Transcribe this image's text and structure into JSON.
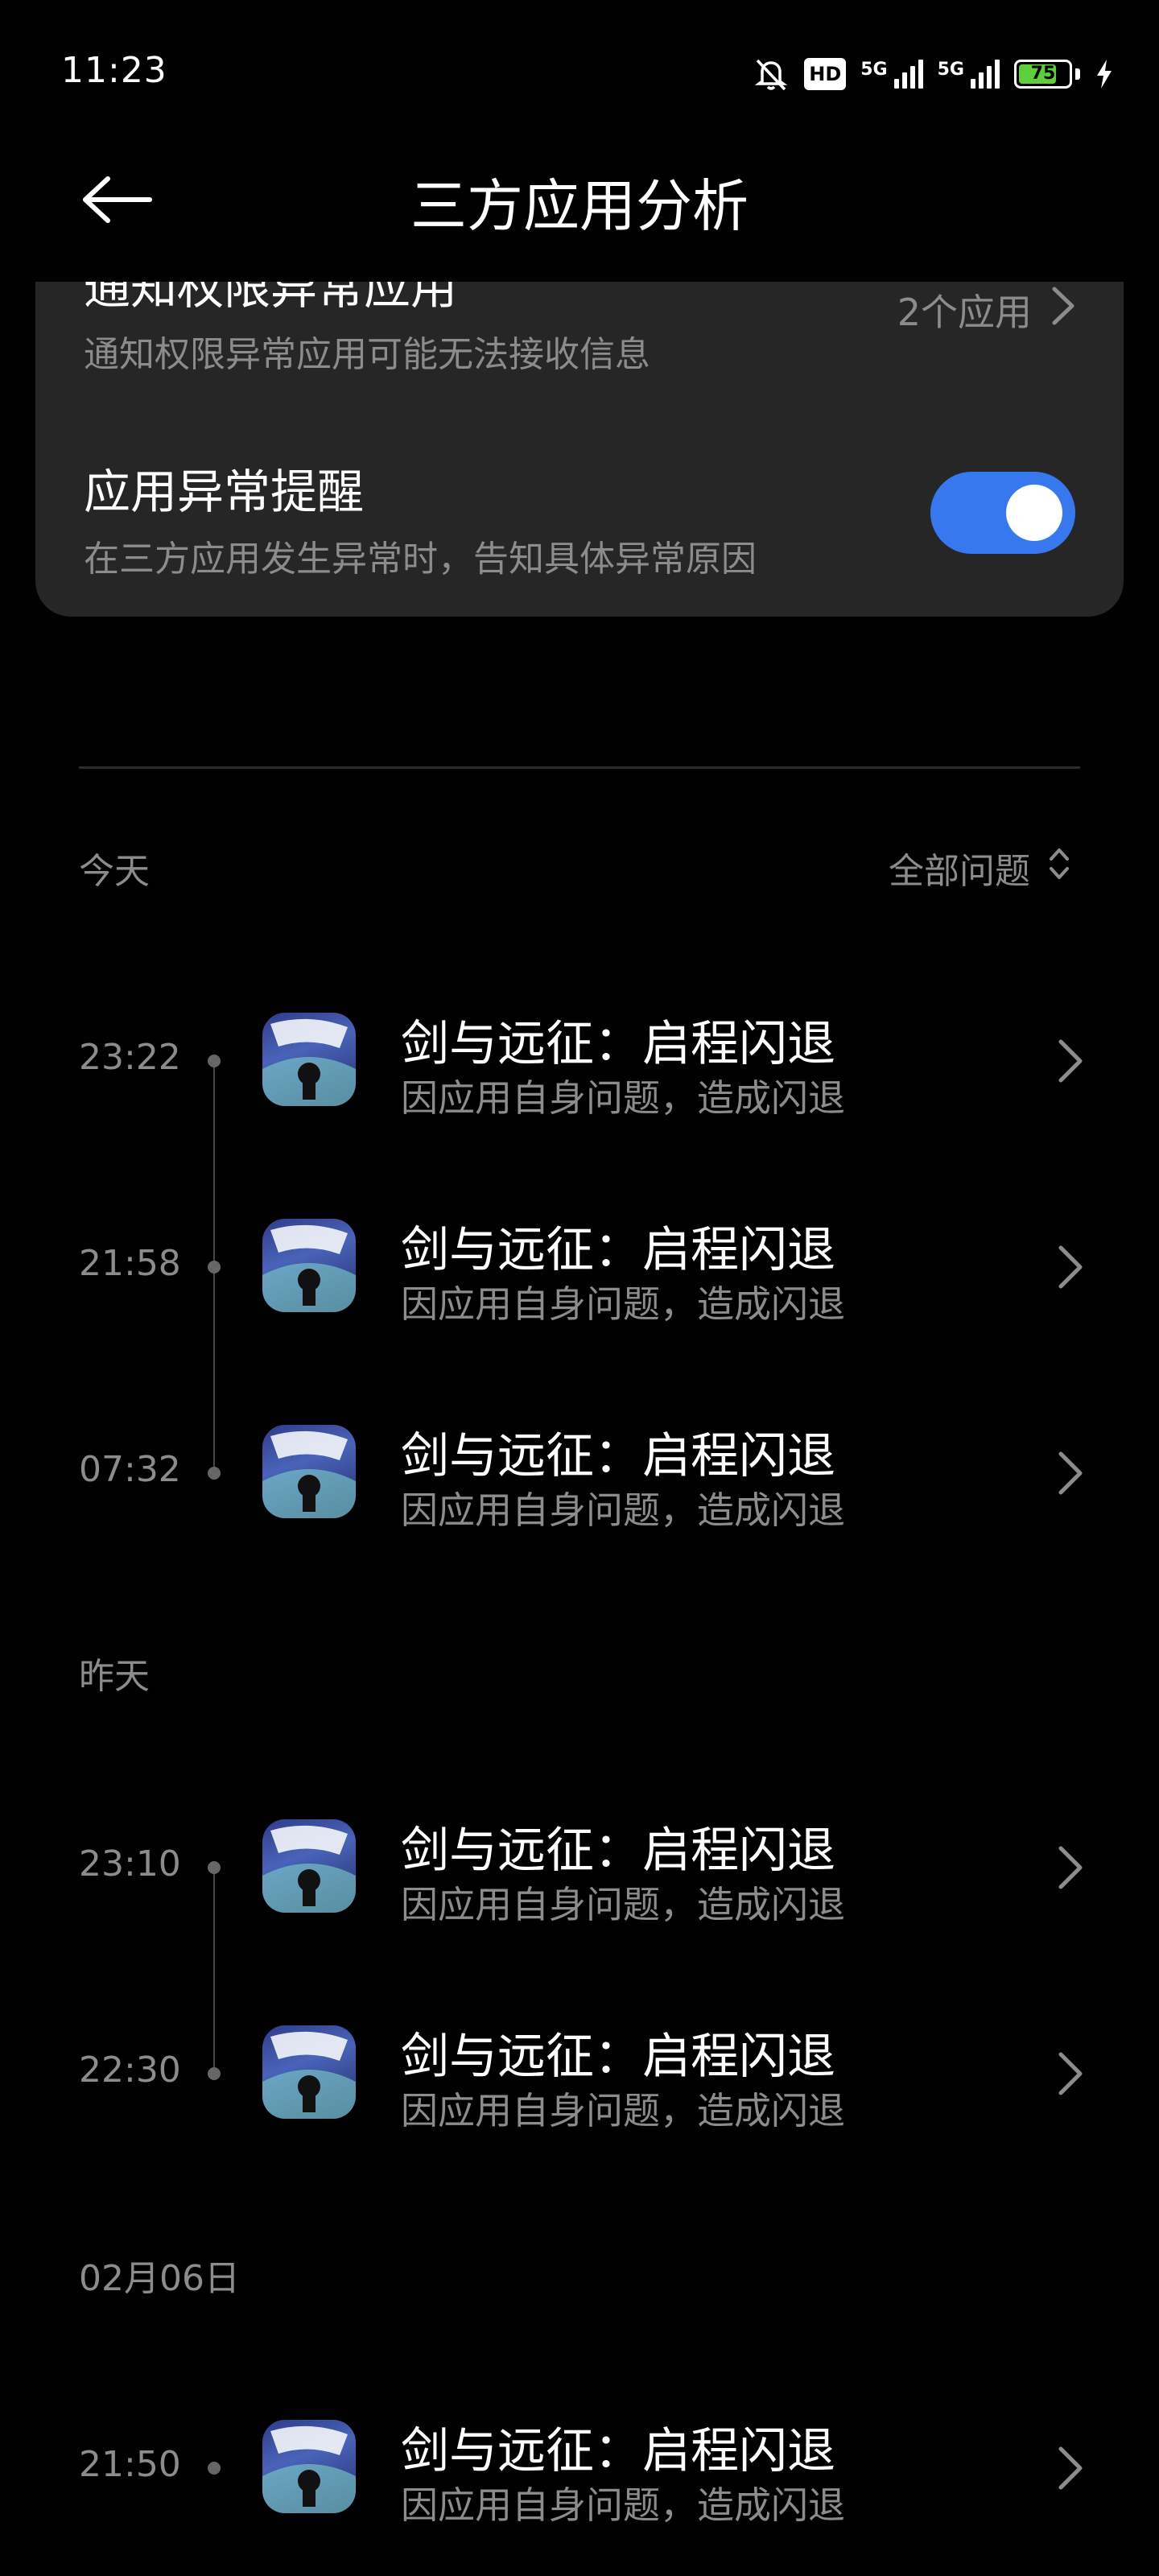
{
  "status_bar": {
    "time": "11:23",
    "hd_label": "HD",
    "network1": "5G",
    "network2": "5G",
    "battery_level": "75",
    "icons": [
      "mute-bell-icon",
      "hd-icon",
      "signal-icon",
      "signal-icon",
      "battery-icon",
      "charging-icon"
    ]
  },
  "header": {
    "title": "三方应用分析",
    "back_icon": "arrow-left-icon"
  },
  "settings": {
    "notification_row": {
      "title": "通知权限异常应用",
      "subtitle": "通知权限异常应用可能无法接收信息",
      "value": "2个应用"
    },
    "alert_row": {
      "title": "应用异常提醒",
      "subtitle": "在三方应用发生异常时，告知具体异常原因",
      "enabled": true
    }
  },
  "filter": {
    "label": "全部问题"
  },
  "sections": [
    {
      "label": "今天",
      "items": [
        {
          "time": "23:22",
          "title": "剑与远征：启程闪退",
          "subtitle": "因应用自身问题，造成闪退"
        },
        {
          "time": "21:58",
          "title": "剑与远征：启程闪退",
          "subtitle": "因应用自身问题，造成闪退"
        },
        {
          "time": "07:32",
          "title": "剑与远征：启程闪退",
          "subtitle": "因应用自身问题，造成闪退"
        }
      ]
    },
    {
      "label": "昨天",
      "items": [
        {
          "time": "23:10",
          "title": "剑与远征：启程闪退",
          "subtitle": "因应用自身问题，造成闪退"
        },
        {
          "time": "22:30",
          "title": "剑与远征：启程闪退",
          "subtitle": "因应用自身问题，造成闪退"
        }
      ]
    },
    {
      "label": "02月06日",
      "items": [
        {
          "time": "21:50",
          "title": "剑与远征：启程闪退",
          "subtitle": "因应用自身问题，造成闪退"
        }
      ]
    }
  ],
  "colors": {
    "background": "#000000",
    "card": "#262626",
    "accent": "#3878ef",
    "secondary_text": "#8c8c8c"
  }
}
